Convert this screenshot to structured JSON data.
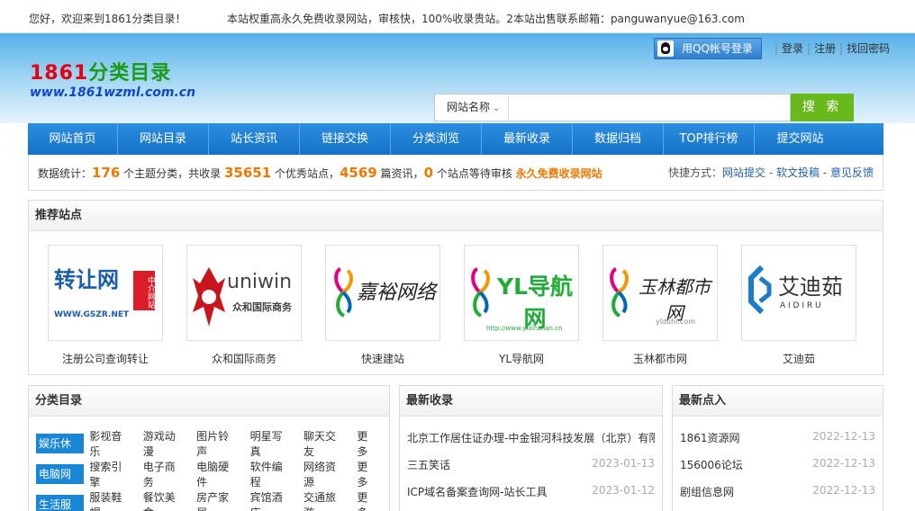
{
  "topbar": {
    "welcome": "您好，欢迎来到1861分类目录！",
    "notice": "本站权重高永久免费收录网站，审核快，100%收录贵站。2本站出售联系邮箱：panguwanyue@163.com"
  },
  "header": {
    "logo_num": "1861",
    "logo_text": "分类目录",
    "logo_url": "www.1861wzml.com.cn",
    "qq_login": "用QQ帐号登录",
    "login": "登录",
    "register": "注册",
    "recover": "找回密码",
    "search": {
      "select_label": "网站名称",
      "placeholder": "",
      "button": "搜 索"
    }
  },
  "nav": {
    "items": [
      "网站首页",
      "网站目录",
      "站长资讯",
      "链接交换",
      "分类浏览",
      "最新收录",
      "数据归档",
      "TOP排行榜",
      "提交网站"
    ]
  },
  "stats": {
    "prefix": "数据统计：",
    "categories": "176",
    "categories_suffix": " 个主题分类，共收录 ",
    "sites": "35651",
    "sites_suffix": " 个优秀站点，",
    "articles": "4569",
    "articles_suffix": " 篇资讯，",
    "pending": "0",
    "pending_suffix": " 个站点等待审核 ",
    "free": "永久免费收录网站",
    "quick_label": "快捷方式：",
    "quick_links": [
      "网站提交",
      "软文投稿",
      "意见反馈"
    ]
  },
  "recommend": {
    "title": "推荐站点",
    "sites": [
      {
        "name": "注册公司查询转让",
        "logo_main": "转让网",
        "logo_sub": "WWW.GSZR.NET",
        "logo_tag": "中介网站"
      },
      {
        "name": "众和国际商务",
        "logo_main": "uniwin",
        "logo_sub": "众和国际商务"
      },
      {
        "name": "快速建站",
        "logo_main": "嘉裕网络"
      },
      {
        "name": "YL导航网",
        "logo_main": "YL导航网",
        "logo_sub": "http://www.yulinzhan.cn"
      },
      {
        "name": "玉林都市网",
        "logo_main": "玉林都市网",
        "logo_sub": "ylduhi.com"
      },
      {
        "name": "艾迪茹",
        "logo_main": "艾迪茹",
        "logo_sub": "A I D I R U"
      }
    ]
  },
  "categories": {
    "title": "分类目录",
    "rows": [
      {
        "tag": "娱乐休闲",
        "items": [
          "影视音乐",
          "游戏动漫",
          "图片铃声",
          "明星写真",
          "聊天交友",
          "更多"
        ]
      },
      {
        "tag": "电脑网络",
        "items": [
          "搜索引擎",
          "电子商务",
          "电脑硬件",
          "软件编程",
          "网络资源",
          "更多"
        ]
      },
      {
        "tag": "生活服务",
        "items": [
          "服装鞋帽",
          "餐饮美食",
          "房产家居",
          "宾馆酒店",
          "交通旅游",
          "更多"
        ]
      }
    ]
  },
  "newest": {
    "title": "最新收录",
    "rows": [
      {
        "name": "北京工作居住证办理-中金银河科技发展（北京）有限公司",
        "date": ""
      },
      {
        "name": "三五笑话",
        "date": "2023-01-13"
      },
      {
        "name": "ICP域名备案查询网-站长工具",
        "date": "2023-01-12"
      }
    ]
  },
  "recent": {
    "title": "最新点入",
    "rows": [
      {
        "name": "1861资源网",
        "date": "2022-12-13"
      },
      {
        "name": "156006论坛",
        "date": "2022-12-13"
      },
      {
        "name": "剧组信息网",
        "date": "2022-12-13"
      }
    ]
  },
  "colors": {
    "accent": "#1a86d6",
    "highlight": "#f07800",
    "search_button": "#69b81c"
  }
}
